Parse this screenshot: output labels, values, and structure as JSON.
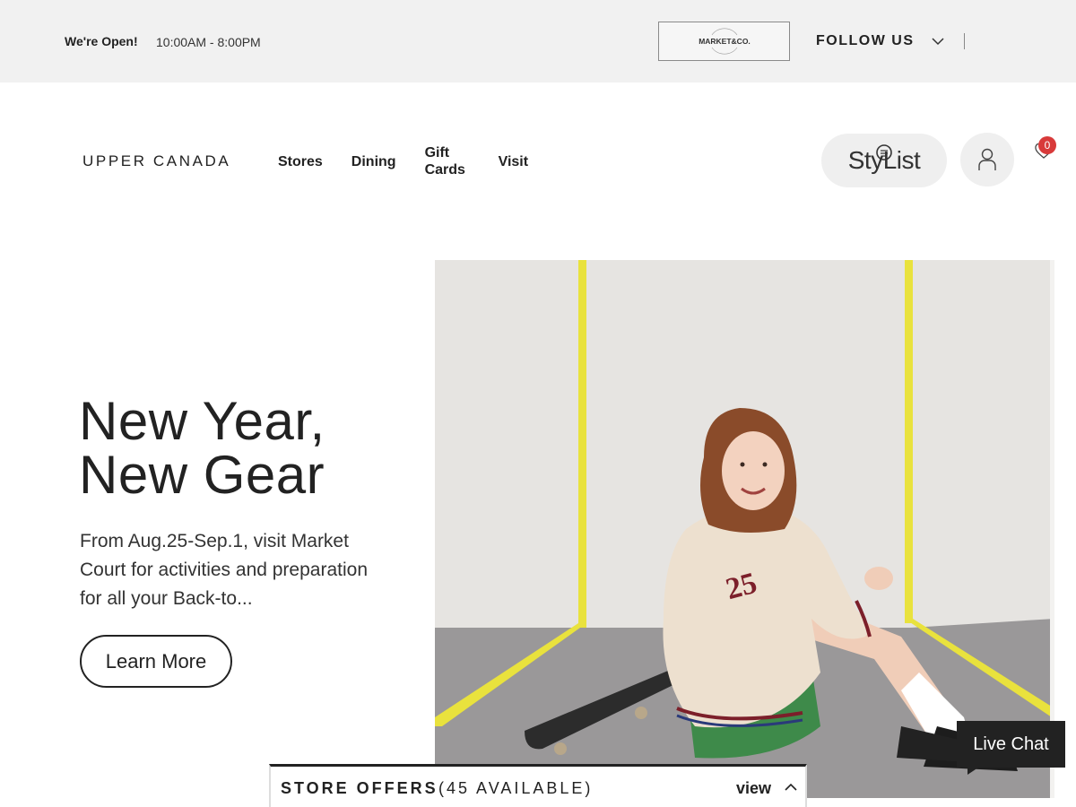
{
  "topbar": {
    "open_label": "We're Open!",
    "hours": "10:00AM - 8:00PM",
    "partner_logo": "MARKET&CO.",
    "follow_label": "FOLLOW US"
  },
  "header": {
    "brand": "UPPER CANADA",
    "nav": [
      "Stores",
      "Dining",
      "Gift Cards",
      "Visit"
    ],
    "stylist_label": "StyList",
    "wishlist_count": "0"
  },
  "hero": {
    "title": "New Year, New Gear",
    "description": "From Aug.25-Sep.1, visit Market Court for activities and preparation for all your Back-to...",
    "cta_label": "Learn More"
  },
  "offers": {
    "label": "STORE OFFERS",
    "count": "(45 AVAILABLE)",
    "view_label": "view"
  },
  "chat": {
    "label": "Live Chat"
  },
  "icons": {
    "follow": "chevron-down-icon",
    "account": "user-icon",
    "wishlist": "heart-icon",
    "stylist": "lightbulb-icon",
    "offers": "chevron-up-icon"
  },
  "colors": {
    "topbar_bg": "#f1f1f1",
    "badge": "#d83a3a",
    "accent_dark": "#222222"
  }
}
